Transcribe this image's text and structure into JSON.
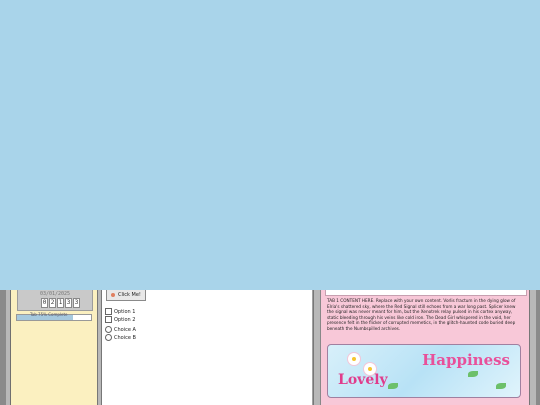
{
  "sidebar": {
    "date": "03/01/2025",
    "counter_digits": [
      "0",
      "2",
      "1",
      "3",
      "3"
    ],
    "progress": {
      "label": "Tab 75% Complete",
      "percent": 75
    }
  },
  "panel": {
    "button_label": "Click Me!",
    "checkboxes": [
      "Option 1",
      "Option 2"
    ],
    "radios": [
      "Choice A",
      "Choice B"
    ]
  },
  "content": {
    "text": "TAB 1 CONTENT HERE. Replace with your own content. Vorlis fractum in the dying glow of Elria's shattered sky, where the Red Signal still echoes from a war long past. Splicer knew the signal was never meant for him, but the Xenotrek relay pulsed in his cortex anyway, static bleeding through his veins like cold iron. The Dead Girl whispered in the void, her presence felt in the flicker of corrupted memetics, in the glitch-haunted code buried deep beneath the Numbspilled archives.",
    "banner": {
      "word_1": "Happiness",
      "word_2": "Lovely"
    }
  }
}
